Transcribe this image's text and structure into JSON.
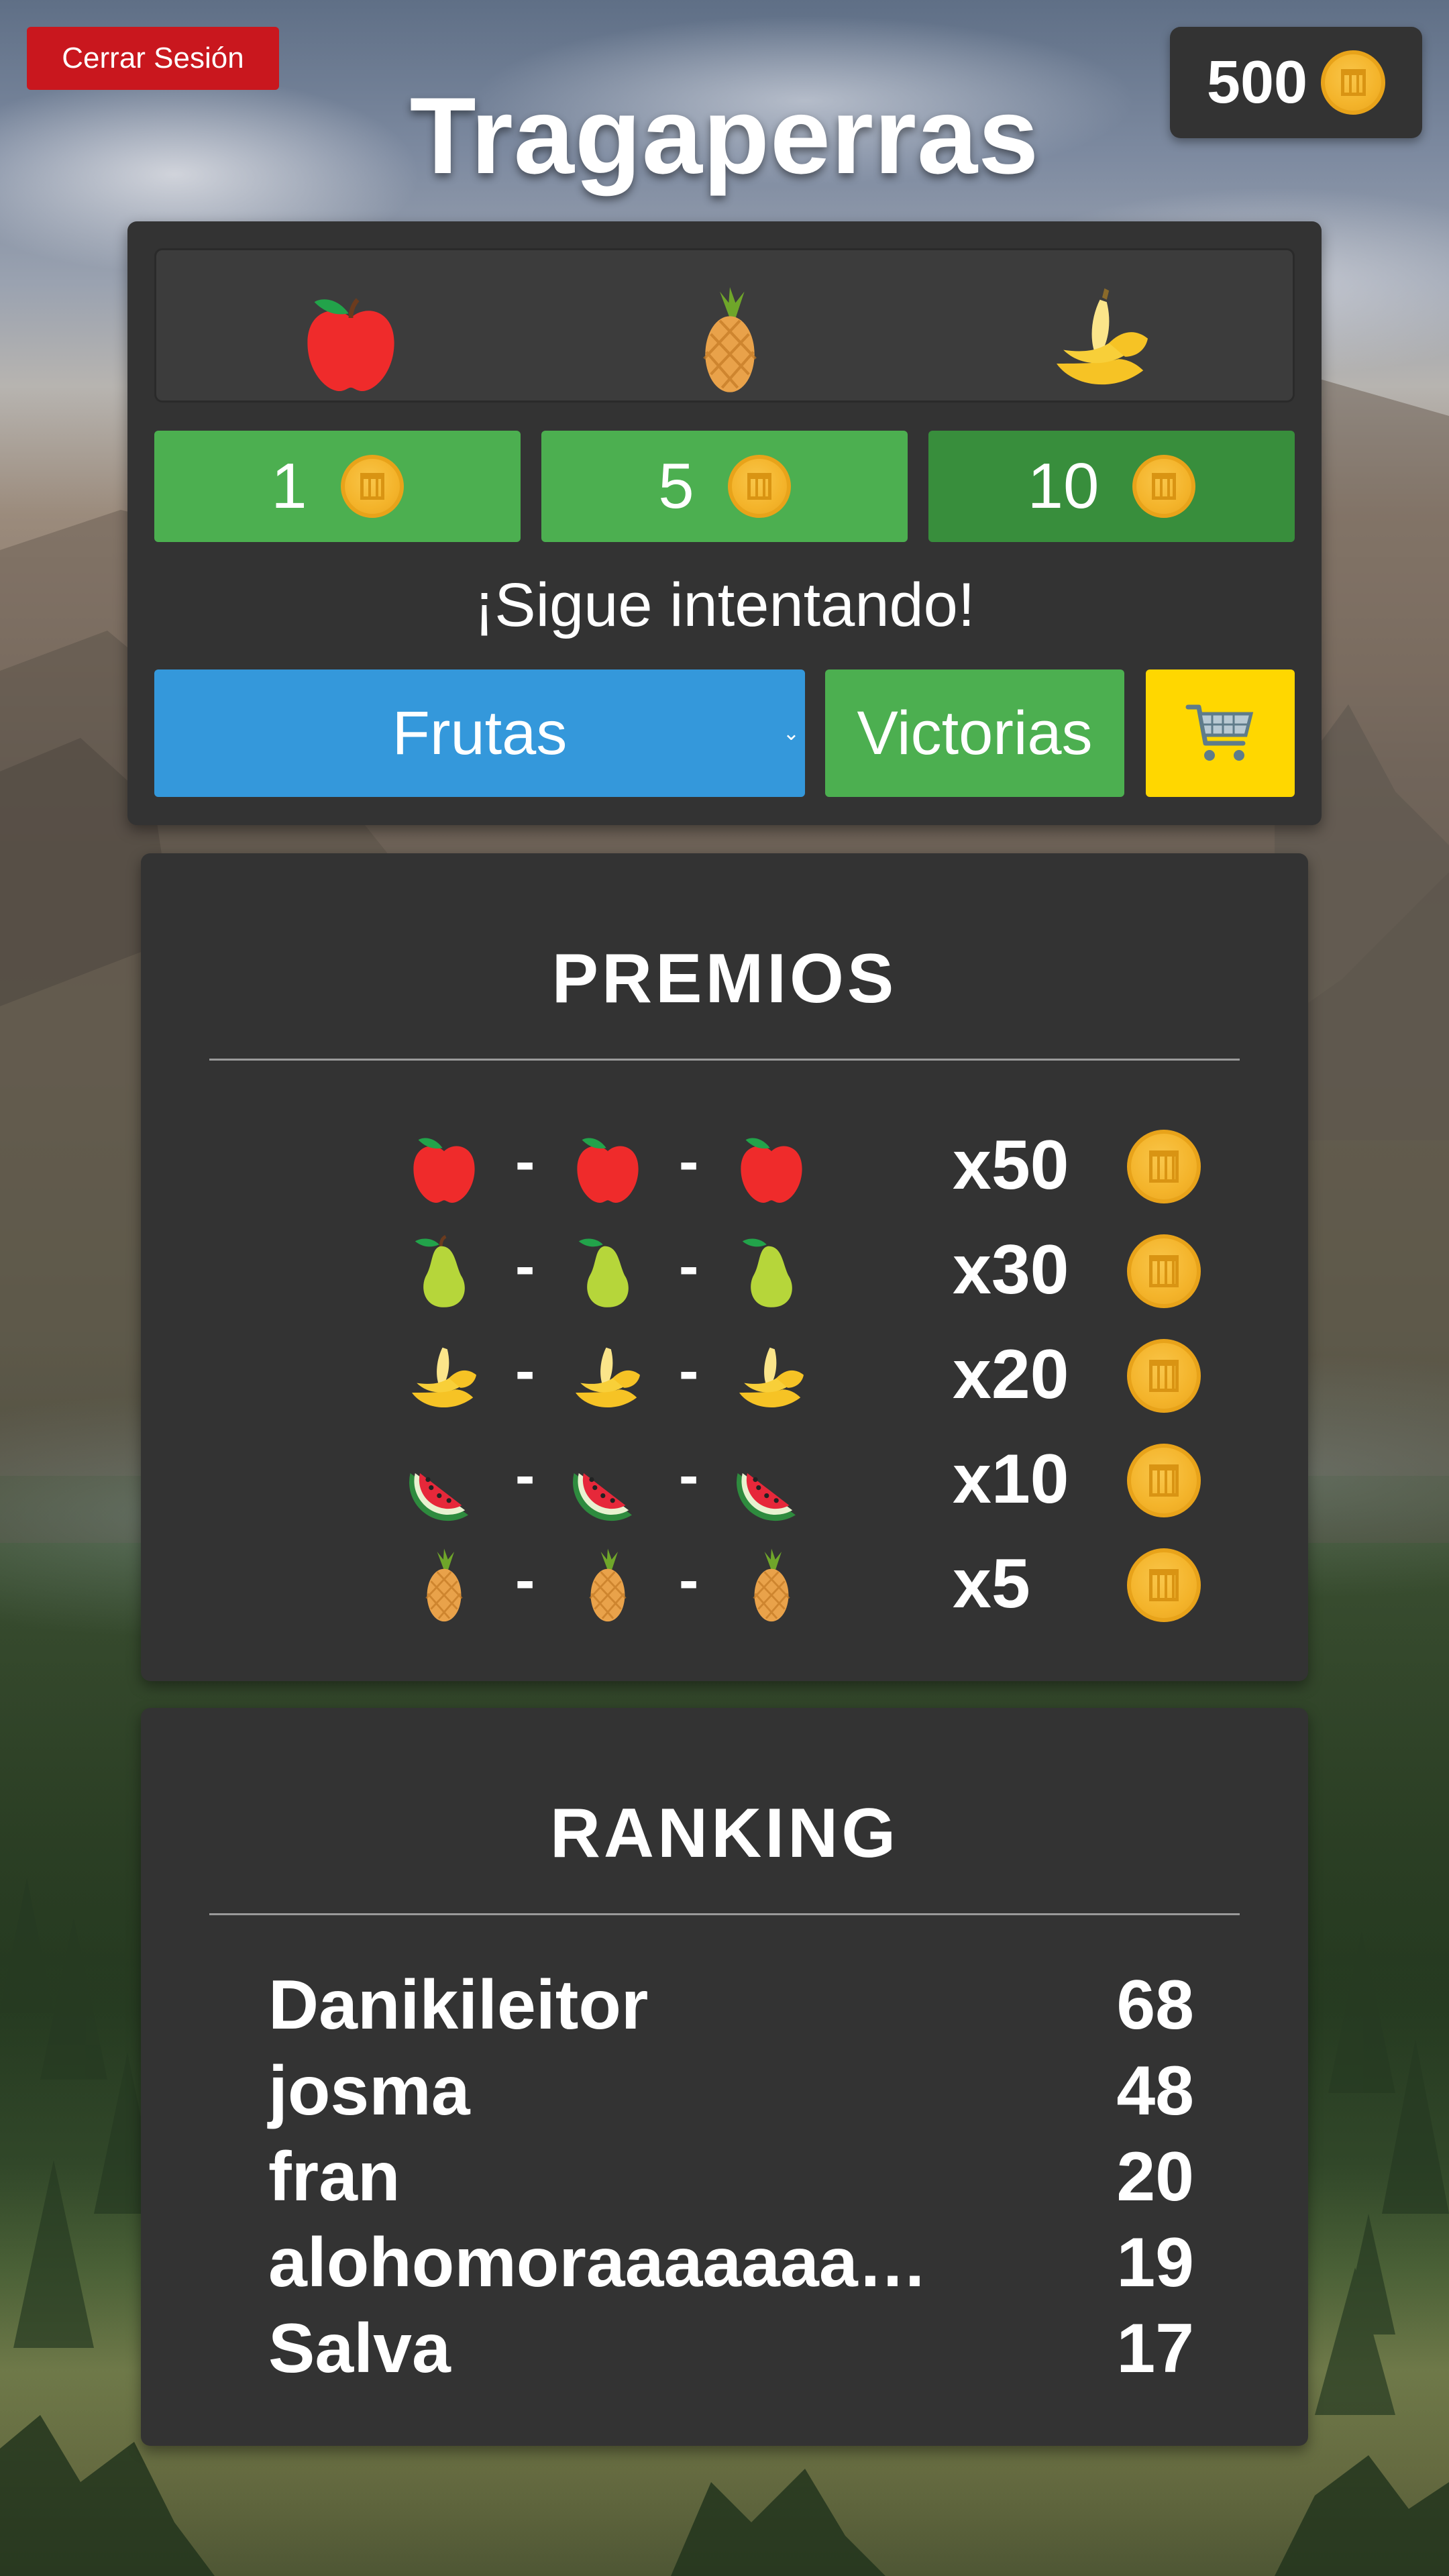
{
  "header": {
    "logout_label": "Cerrar Sesión",
    "coins": "500",
    "title": "Tragaperras"
  },
  "machine": {
    "reels": [
      "apple-icon",
      "pineapple-icon",
      "banana-icon"
    ],
    "bets": [
      {
        "label": "1",
        "color": "#4caf50"
      },
      {
        "label": "5",
        "color": "#4caf50"
      },
      {
        "label": "10",
        "color": "#388e3c"
      }
    ],
    "status": "¡Sigue intentando!",
    "theme_select": "Frutas",
    "wins_label": "Victorias",
    "shop_icon": "cart-icon"
  },
  "prizes": {
    "title": "PREMIOS",
    "rows": [
      {
        "fruit": "apple-icon",
        "multiplier": "x50"
      },
      {
        "fruit": "pear-icon",
        "multiplier": "x30"
      },
      {
        "fruit": "banana-icon",
        "multiplier": "x20"
      },
      {
        "fruit": "watermelon-icon",
        "multiplier": "x10"
      },
      {
        "fruit": "pineapple-icon",
        "multiplier": "x5"
      }
    ],
    "separator": "-"
  },
  "ranking": {
    "title": "RANKING",
    "rows": [
      {
        "name": "Danikileitor",
        "score": "68"
      },
      {
        "name": "josma",
        "score": "48"
      },
      {
        "name": "fran",
        "score": "20"
      },
      {
        "name": "alohomoraaaaaaa…",
        "score": "19"
      },
      {
        "name": "Salva",
        "score": "17"
      }
    ]
  },
  "colors": {
    "logout": "#c9171e",
    "panel": "#333333",
    "select": "#3498db",
    "green": "#4caf50",
    "shop": "#ffd700",
    "coin": "#f4b42b"
  }
}
